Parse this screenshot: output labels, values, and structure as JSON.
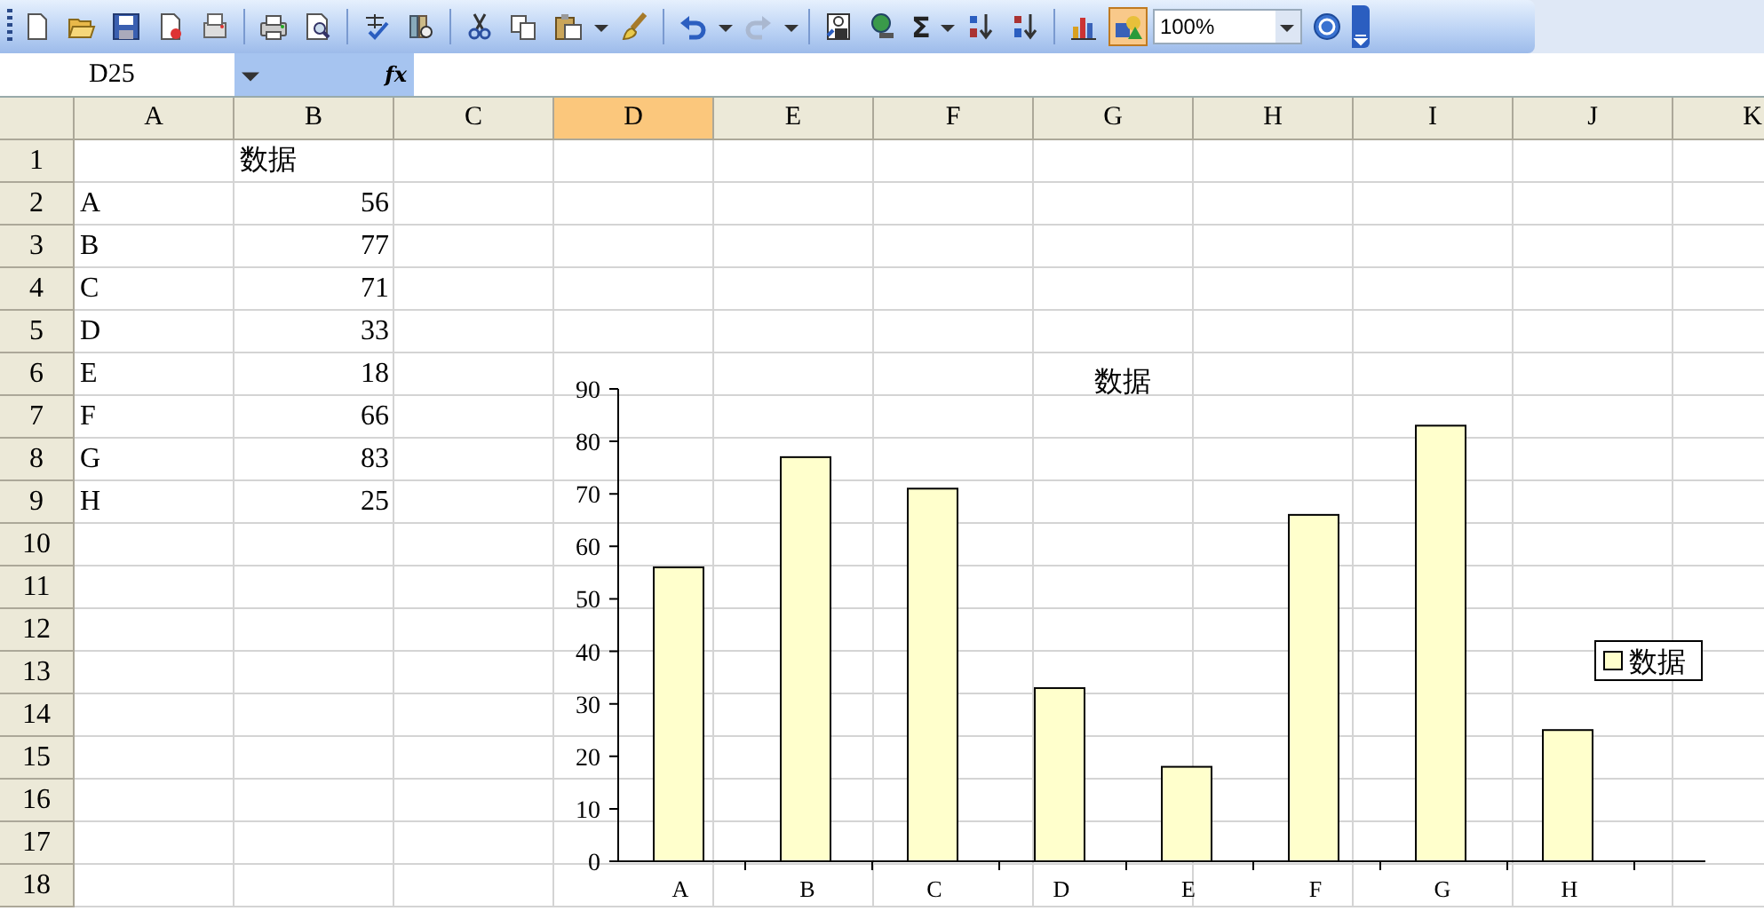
{
  "toolbar": {
    "sum_symbol": "Σ",
    "zoom": "100%",
    "drawing_active": true
  },
  "formula_bar": {
    "name_box": "D25",
    "function_label": "fx"
  },
  "columns": [
    {
      "label": "A",
      "selected": false
    },
    {
      "label": "B",
      "selected": false
    },
    {
      "label": "C",
      "selected": false
    },
    {
      "label": "D",
      "selected": true
    },
    {
      "label": "E",
      "selected": false
    },
    {
      "label": "F",
      "selected": false
    },
    {
      "label": "G",
      "selected": false
    },
    {
      "label": "H",
      "selected": false
    },
    {
      "label": "I",
      "selected": false
    },
    {
      "label": "J",
      "selected": false
    },
    {
      "label": "K",
      "selected": false
    }
  ],
  "rows": [
    {
      "header": "1",
      "b": {
        "text": "数据",
        "numeric": false
      }
    },
    {
      "header": "2",
      "a": {
        "text": "A",
        "numeric": false
      },
      "b": {
        "text": "56",
        "numeric": true
      }
    },
    {
      "header": "3",
      "a": {
        "text": "B",
        "numeric": false
      },
      "b": {
        "text": "77",
        "numeric": true
      }
    },
    {
      "header": "4",
      "a": {
        "text": "C",
        "numeric": false
      },
      "b": {
        "text": "71",
        "numeric": true
      }
    },
    {
      "header": "5",
      "a": {
        "text": "D",
        "numeric": false
      },
      "b": {
        "text": "33",
        "numeric": true
      }
    },
    {
      "header": "6",
      "a": {
        "text": "E",
        "numeric": false
      },
      "b": {
        "text": "18",
        "numeric": true
      }
    },
    {
      "header": "7",
      "a": {
        "text": "F",
        "numeric": false
      },
      "b": {
        "text": "66",
        "numeric": true
      }
    },
    {
      "header": "8",
      "a": {
        "text": "G",
        "numeric": false
      },
      "b": {
        "text": "83",
        "numeric": true
      }
    },
    {
      "header": "9",
      "a": {
        "text": "H",
        "numeric": false
      },
      "b": {
        "text": "25",
        "numeric": true
      }
    },
    {
      "header": "10"
    },
    {
      "header": "11"
    },
    {
      "header": "12"
    },
    {
      "header": "13"
    },
    {
      "header": "14"
    },
    {
      "header": "15"
    },
    {
      "header": "16"
    },
    {
      "header": "17"
    },
    {
      "header": "18"
    }
  ],
  "chart": {
    "chart_data": {
      "type": "bar",
      "title": "数据",
      "categories": [
        "A",
        "B",
        "C",
        "D",
        "E",
        "F",
        "G",
        "H"
      ],
      "series": [
        {
          "name": "数据",
          "color": "#ffffcc",
          "values": [
            56,
            77,
            71,
            33,
            18,
            66,
            83,
            25
          ]
        }
      ],
      "ylim": [
        0,
        90
      ],
      "yticks": [
        0,
        10,
        20,
        30,
        40,
        50,
        60,
        70,
        80,
        90
      ]
    }
  }
}
